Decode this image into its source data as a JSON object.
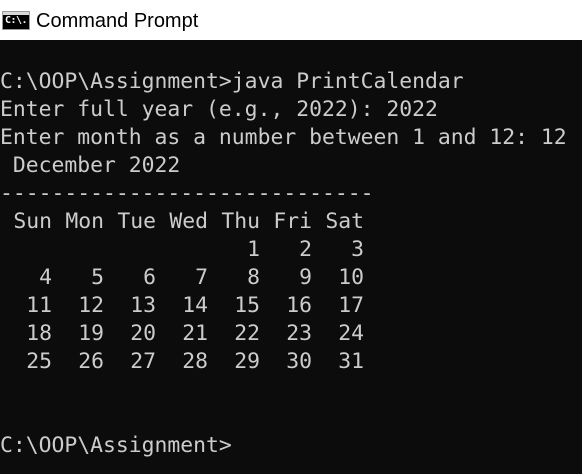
{
  "window": {
    "title": "Command Prompt",
    "icon": "command-prompt-icon",
    "icon_glyph": "C:\\.",
    "background_color": "#0c0c0c",
    "text_color": "#cccccc"
  },
  "console": {
    "command_line": "C:\\OOP\\Assignment>java PrintCalendar",
    "year_prompt": "Enter full year (e.g., 2022): 2022",
    "month_prompt": "Enter month as a number between 1 and 12: 12",
    "calendar_title": " December 2022",
    "separator": "-----------------------------",
    "weekday_headers": [
      "Sun",
      "Mon",
      "Tue",
      "Wed",
      "Thu",
      "Fri",
      "Sat"
    ],
    "weeks": [
      [
        "",
        "",
        "",
        "",
        "1",
        "2",
        "3"
      ],
      [
        "4",
        "5",
        "6",
        "7",
        "8",
        "9",
        "10"
      ],
      [
        "11",
        "12",
        "13",
        "14",
        "15",
        "16",
        "17"
      ],
      [
        "18",
        "19",
        "20",
        "21",
        "22",
        "23",
        "24"
      ],
      [
        "25",
        "26",
        "27",
        "28",
        "29",
        "30",
        "31"
      ]
    ],
    "final_prompt": "C:\\OOP\\Assignment>"
  }
}
